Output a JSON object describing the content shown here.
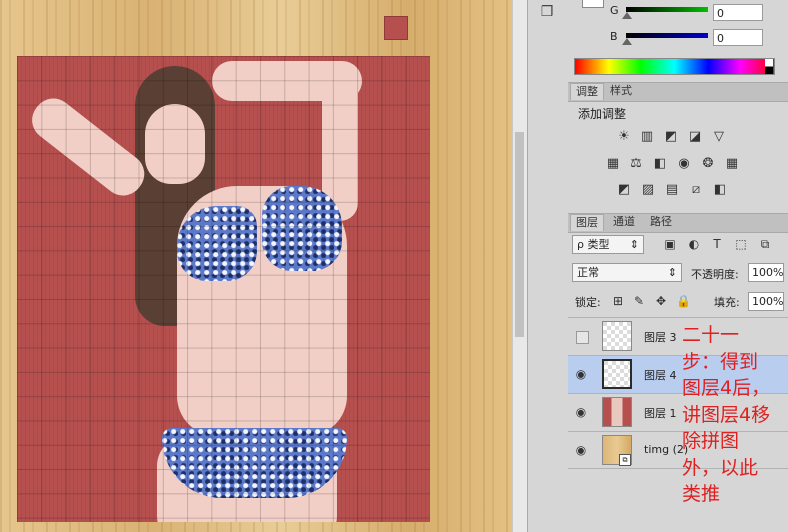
{
  "canvas": {
    "photo_description_label": ""
  },
  "color_panel": {
    "g_label": "G",
    "g_value": "0",
    "b_label": "B",
    "b_value": "0",
    "g_color": "#00b000",
    "b_color": "#0000c8"
  },
  "adjust_tabs": {
    "tab_adjust": "调整",
    "tab_style": "样式",
    "add_adjustment": "添加调整",
    "icons_row1": [
      "brightness-icon",
      "levels-icon",
      "curves-icon",
      "exposure-icon",
      "vibrance-icon"
    ],
    "icons_row2": [
      "hue-saturation-icon",
      "color-balance-icon",
      "black-white-icon",
      "photo-filter-icon",
      "channel-mixer-icon",
      "color-lookup-icon"
    ],
    "icons_row3": [
      "invert-icon",
      "posterize-icon",
      "threshold-icon",
      "selective-color-icon",
      "gradient-map-icon"
    ]
  },
  "layers_panel": {
    "tab_layers": "图层",
    "tab_channels": "通道",
    "tab_paths": "路径",
    "filter_type": "类型",
    "filter_glyph": "ρ",
    "blend_mode": "正常",
    "opacity_label": "不透明度:",
    "opacity_value": "100%",
    "lock_label": "锁定:",
    "fill_label": "填充:",
    "fill_value": "100%",
    "layers": [
      {
        "name": "图层 3",
        "visible": false,
        "selected": false
      },
      {
        "name": "图层 4",
        "visible": true,
        "selected": true
      },
      {
        "name": "图层 1",
        "visible": true,
        "selected": false
      },
      {
        "name": "timg (2)",
        "visible": true,
        "selected": false
      }
    ]
  },
  "annotation": {
    "text": "二十一步：得到图层4后，讲图层4移除拼图外，以此类推",
    "lines": [
      "二十一",
      "步：得到",
      "图层4后，",
      "讲图层4移",
      "除拼图",
      "外，以此",
      "类推"
    ],
    "color": "#e02020"
  }
}
